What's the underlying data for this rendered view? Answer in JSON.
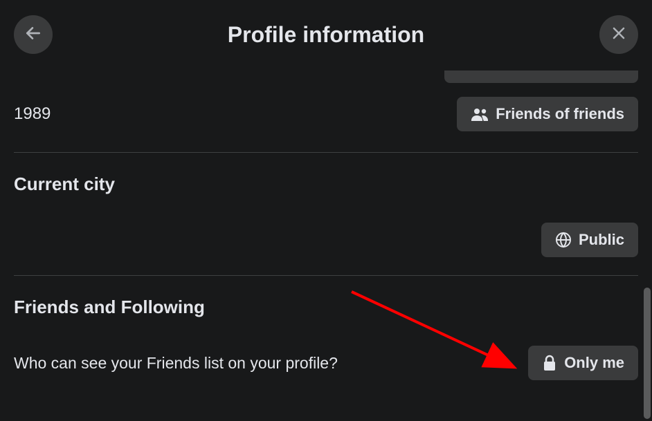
{
  "header": {
    "title": "Profile information"
  },
  "rows": {
    "yearValue": "1989",
    "yearPrivacyLabel": "Friends of friends"
  },
  "sections": {
    "currentCity": {
      "title": "Current city",
      "privacyLabel": "Public"
    },
    "friendsFollowing": {
      "title": "Friends and Following",
      "question": "Who can see your Friends list on your profile?",
      "privacyLabel": "Only me"
    }
  }
}
